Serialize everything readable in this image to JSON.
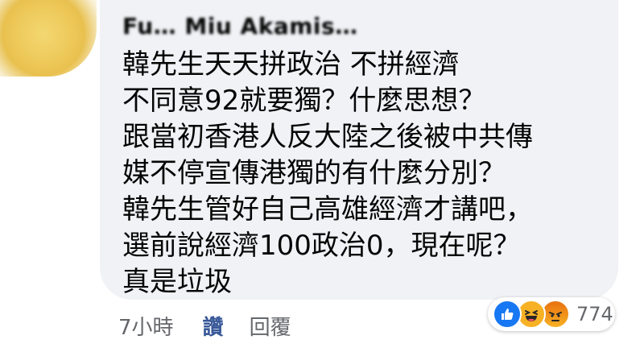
{
  "comment": {
    "author": "Fu… Miu Akamis…",
    "lines": [
      "韓先生天天拼政治 不拼經濟",
      "不同意92就要獨？什麼思想？",
      "跟當初香港人反大陸之後被中共傳",
      "媒不停宣傳港獨的有什麼分別？",
      "韓先生管好自己高雄經濟才講吧，",
      "選前說經濟100政治0，現在呢？",
      "真是垃圾"
    ]
  },
  "actions": {
    "timestamp": "7小時",
    "like_label": "讚",
    "reply_label": "回覆"
  },
  "reactions": {
    "types": [
      "like-icon",
      "haha-icon",
      "angry-icon"
    ],
    "count": "774"
  },
  "colors": {
    "bubble": "#f0f2f5",
    "like_blue": "#385898",
    "secondary_text": "#65676b"
  }
}
